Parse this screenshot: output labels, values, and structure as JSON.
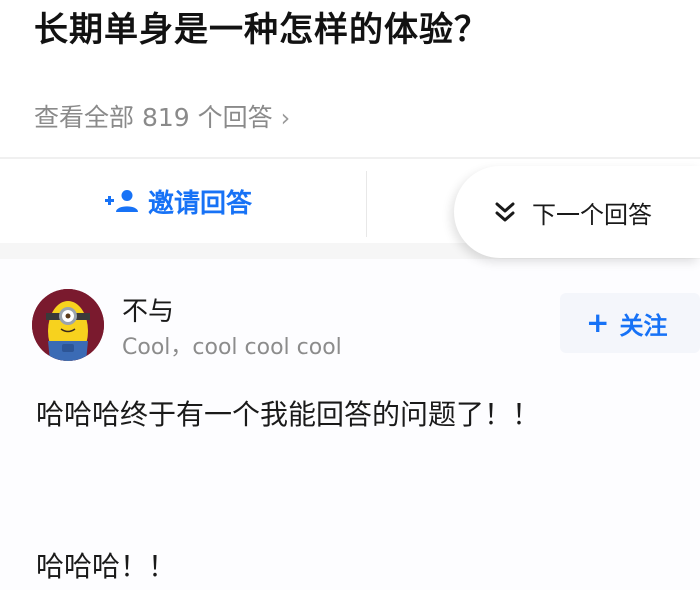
{
  "question": {
    "title": "长期单身是一种怎样的体验？",
    "view_all": "查看全部 819 个回答",
    "view_all_chevron": "›"
  },
  "actions": {
    "invite_label": "邀请回答",
    "invite_icon": "add-user-icon",
    "next_label": "下一个回答",
    "next_icon": "double-chevron-down-icon"
  },
  "answer": {
    "author_name": "不与",
    "author_bio": "Cool，cool cool cool",
    "follow_label": "关注",
    "follow_plus": "+",
    "avatar_icon": "minion-avatar",
    "content": [
      "哈哈哈终于有一个我能回答的问题了！！",
      "哈哈哈！！"
    ]
  },
  "colors": {
    "accent": "#1772f6",
    "muted_text": "#8a8a8a",
    "title_text": "#121212",
    "avatar_bg": "#7a1a2e"
  }
}
